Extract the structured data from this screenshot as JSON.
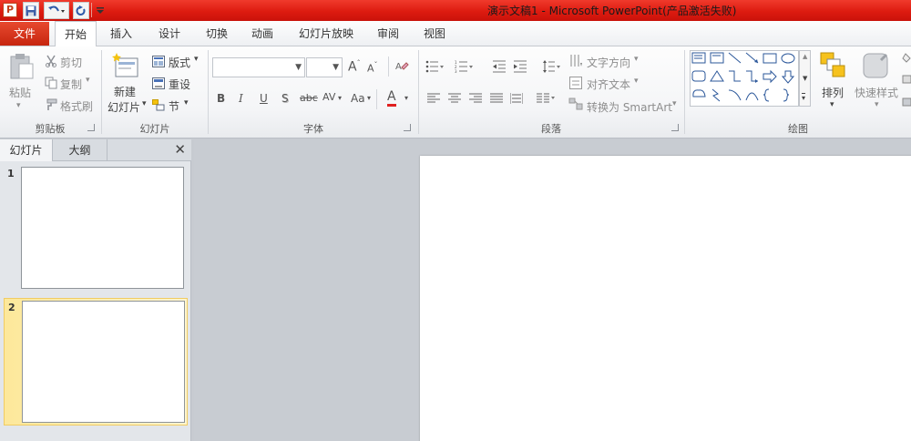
{
  "titlebar": {
    "app_logo": "P",
    "title": "演示文稿1  -  Microsoft PowerPoint(产品激活失败)"
  },
  "tabs": {
    "file": "文件",
    "items": [
      "开始",
      "插入",
      "设计",
      "切换",
      "动画",
      "幻灯片放映",
      "审阅",
      "视图"
    ],
    "active": "开始"
  },
  "ribbon": {
    "clipboard": {
      "paste": "粘贴",
      "cut": "剪切",
      "copy": "复制",
      "format_painter": "格式刷",
      "label": "剪贴板"
    },
    "slides": {
      "new_slide_line1": "新建",
      "new_slide_line2": "幻灯片",
      "layout": "版式",
      "reset": "重设",
      "section": "节",
      "label": "幻灯片"
    },
    "font": {
      "label": "字体",
      "format_buttons": [
        "B",
        "I",
        "U",
        "S",
        "abc",
        "AV",
        "Aa",
        "A"
      ]
    },
    "paragraph": {
      "text_direction": "文字方向",
      "align_text": "对齐文本",
      "convert_smartart": "转换为 SmartArt",
      "label": "段落"
    },
    "drawing": {
      "arrange": "排列",
      "quick_styles": "快速样式",
      "label": "绘图"
    }
  },
  "panel": {
    "tab_slides": "幻灯片",
    "tab_outline": "大纲",
    "close": "✕",
    "thumbnails": [
      {
        "number": "1"
      },
      {
        "number": "2"
      }
    ]
  },
  "colors": {
    "titlebar": "#dd1b10",
    "file_tab": "#d33a1f",
    "selected_thumb": "#fde89a"
  }
}
